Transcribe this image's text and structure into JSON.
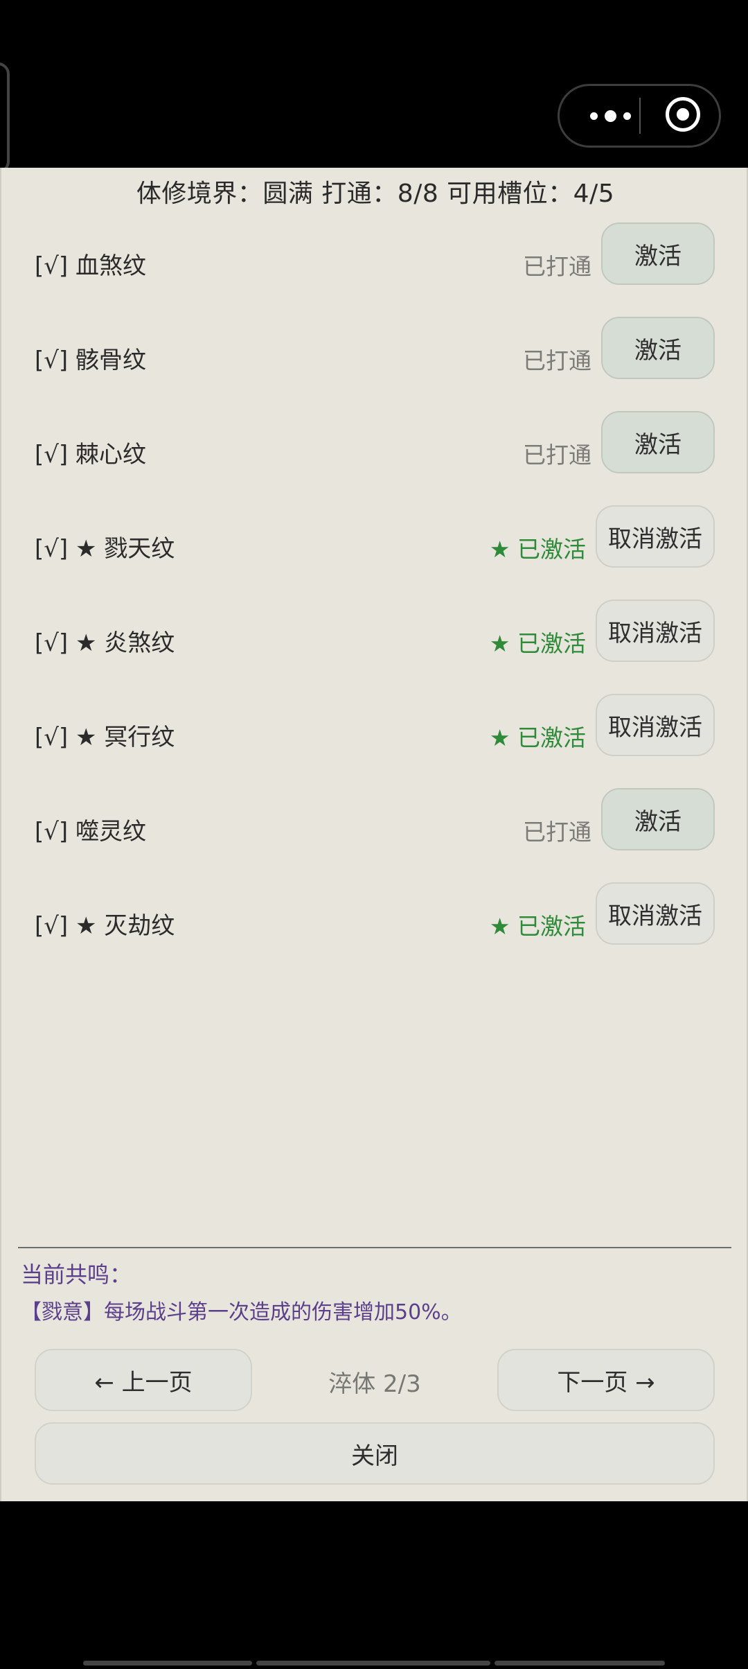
{
  "header": {
    "summary": "体修境界：圆满 打通：8/8 可用槽位：4/5"
  },
  "rows": [
    {
      "name": "[√] 血煞纹",
      "status": "已打通",
      "button": "激活",
      "state": "opened"
    },
    {
      "name": "[√] 骸骨纹",
      "status": "已打通",
      "button": "激活",
      "state": "opened"
    },
    {
      "name": "[√] 棘心纹",
      "status": "已打通",
      "button": "激活",
      "state": "opened"
    },
    {
      "name": "[√] ★ 戮天纹",
      "status": "★ 已激活",
      "button": "取消激活",
      "state": "active"
    },
    {
      "name": "[√] ★ 炎煞纹",
      "status": "★ 已激活",
      "button": "取消激活",
      "state": "active"
    },
    {
      "name": "[√] ★ 冥行纹",
      "status": "★ 已激活",
      "button": "取消激活",
      "state": "active"
    },
    {
      "name": "[√] 噬灵纹",
      "status": "已打通",
      "button": "激活",
      "state": "opened"
    },
    {
      "name": "[√] ★ 灭劫纹",
      "status": "★ 已激活",
      "button": "取消激活",
      "state": "active"
    }
  ],
  "resonance": {
    "title": "当前共鸣：",
    "text": "【戮意】每场战斗第一次造成的伤害增加50%。"
  },
  "nav": {
    "prev_label": "← 上一页",
    "page_indicator": "淬体 2/3",
    "next_label": "下一页 →",
    "close_label": "关闭"
  },
  "colors": {
    "panel_bg": "#e8e6dc",
    "active_green": "#2f8a3a",
    "opened_gray": "#7b7b78",
    "resonance_purple": "#5b3f8c"
  }
}
